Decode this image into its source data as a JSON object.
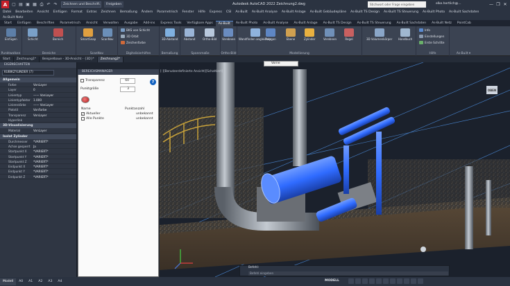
{
  "titlebar": {
    "logo": "A",
    "workspace": "Zeichnen und Beschrift...",
    "share": "Freigeben",
    "title": "Autodesk AutoCAD 2022   Zeichnung2.dwg",
    "search_placeholder": "Stichwort oder Frage eingeben",
    "user": "elke.hertlich@...",
    "minimize": "—",
    "maximize": "❐",
    "close": "✕"
  },
  "menu": {
    "items": [
      "Datei",
      "Bearbeiten",
      "Ansicht",
      "Einfügen",
      "Format",
      "Extras",
      "Zeichnen",
      "Bemaßung",
      "Ändern",
      "Parametrisch",
      "Fenster",
      "Hilfe",
      "Express",
      "CSI",
      "As-Built",
      "As-Built Analyse",
      "As-Built Anlage",
      "As-Built Gebäudepläne",
      "As-Built TS Design",
      "As-Built TS Steuerung",
      "As-Built Photo",
      "As-Built Sachdaten"
    ],
    "second_row": "As-Built Netz"
  },
  "ribbon_tabs": [
    "Start",
    "Einfügen",
    "Beschriften",
    "Parametrisch",
    "Ansicht",
    "Verwalten",
    "Ausgabe",
    "Add-ins",
    "Express Tools",
    "Verfügbare Apps",
    "As-Built",
    "As-Built Photo",
    "As-Built Analyse",
    "As-Built Anlage",
    "As-Built TS Design",
    "As-Built TS Steuerung",
    "As-Built Sachdaten",
    "As-Built Netz",
    "PointCab"
  ],
  "ribbon_active": "As-Built",
  "ribbon": {
    "groups": [
      {
        "label": "Punktwolken",
        "buttons": [
          "Einfügen"
        ]
      },
      {
        "label": "Bereiche",
        "buttons": [
          "Schicht",
          "Bereich"
        ]
      },
      {
        "label": "ScanNav",
        "buttons": [
          "SmartSnap",
          "ScanNav"
        ]
      },
      {
        "label": "Digitalisierhilfen",
        "small": [
          "BKS von Schicht",
          "3D Orbit",
          "Zeichenfarbe"
        ]
      },
      {
        "label": "Bemaßung",
        "buttons": [
          "3D-Abstand"
        ]
      },
      {
        "label": "Spannmaße",
        "buttons": [
          "Abstand",
          "Ortho-Bild"
        ]
      },
      {
        "label": "Ortho-Bild",
        "buttons": [
          "Ortho-Bild",
          "Verebnen"
        ]
      },
      {
        "label": "Modellierung",
        "buttons": [
          "Wandfinden angleichen",
          "Polygon",
          "Ebene",
          "Zylinder",
          "Verebnen",
          "Regel"
        ]
      },
      {
        "label": "",
        "buttons": [
          "3D Volumenkörper",
          "Handbuch"
        ]
      },
      {
        "label": "Hilfe",
        "small": [
          "Info",
          "Einstellungen",
          "Erste Schritte"
        ]
      },
      {
        "label": "As-Built ▾",
        "buttons": []
      }
    ]
  },
  "doc_tabs": [
    "Start",
    "Zeichnung1*",
    "Beispielbaue - 3D-Ansicht - {3D}*",
    "Zeichnung2*"
  ],
  "doc_active": 3,
  "properties": {
    "title": "EIGENSCHAFTEN",
    "selection": "KUBIKZYLINDER (7)",
    "general_header": "Allgemein",
    "general": [
      {
        "k": "Farbe",
        "v": "VonLayer"
      },
      {
        "k": "Layer",
        "v": "0"
      },
      {
        "k": "Linientyp",
        "v": "—— VonLayer"
      },
      {
        "k": "Linientypfaktor",
        "v": "1.000"
      },
      {
        "k": "Linienstärke",
        "v": "—— VonLayer"
      },
      {
        "k": "Plotstil",
        "v": "VonFarbe"
      },
      {
        "k": "Transparenz",
        "v": "VonLayer"
      },
      {
        "k": "Hyperlink",
        "v": ""
      }
    ],
    "viz_header": "3D-Visualisierung",
    "viz": [
      {
        "k": "Material",
        "v": "VonLayer"
      }
    ],
    "cyl_header": "Isolat Zylinder",
    "cyl": [
      {
        "k": "Durchmesser",
        "v": "*VARIERT*"
      },
      {
        "k": "Achse gesperrt",
        "v": "Ja"
      },
      {
        "k": "Startpunkt X",
        "v": "*VARIERT*"
      },
      {
        "k": "Startpunkt Y",
        "v": "*VARIERT*"
      },
      {
        "k": "Startpunkt Z",
        "v": "*VARIERT*"
      },
      {
        "k": "Endpunkt X",
        "v": "*VARIERT*"
      },
      {
        "k": "Endpunkt Y",
        "v": "*VARIERT*"
      },
      {
        "k": "Endpunkt Z",
        "v": "*VARIERT*"
      }
    ]
  },
  "bereichsmanager": {
    "title": "BEREICHSMANAGER",
    "transparency_label": "Transparenz",
    "transparency_value": "60",
    "point_size_label": "Punktgröße",
    "point_size_value": "3",
    "help": "?",
    "col_name": "Name",
    "col_count": "Punktanzahl",
    "rows": [
      {
        "name": "Aktueller",
        "count": "unbekannt",
        "checked": true
      },
      {
        "name": "Alle Punkte",
        "count": "unbekannt",
        "checked": false
      }
    ]
  },
  "viewport": {
    "label": "[-][Benutzerdefinierte Ansicht][Schattiert]",
    "view_select": "Vorne",
    "viewcube": "OBEN",
    "colors": {
      "cylinder": "#2f6bff",
      "pipe": "#9aa3ad",
      "platform": "#c8a23a",
      "guide": "#4d8fe0"
    }
  },
  "command": {
    "history": "Befehl:",
    "placeholder": "Befehl eingeben"
  },
  "status": {
    "tabs": [
      "Modell",
      "A0",
      "A1",
      "A2",
      "A3",
      "A4"
    ],
    "mode": "MODELL"
  }
}
